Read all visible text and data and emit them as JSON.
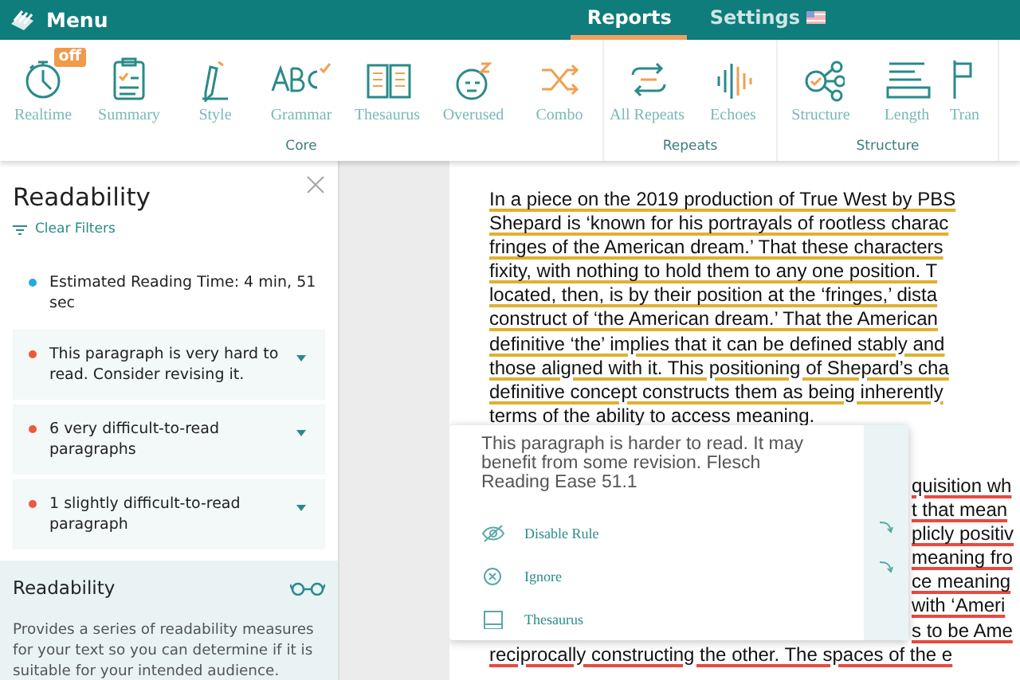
{
  "header": {
    "menu": "Menu",
    "tabs": [
      {
        "label": "Reports",
        "selected": true
      },
      {
        "label": "Settings",
        "selected": false
      }
    ]
  },
  "toolbar": {
    "groups": [
      {
        "label": "Core",
        "items": [
          {
            "label": "Realtime",
            "badge": "off"
          },
          {
            "label": "Summary"
          },
          {
            "label": "Style"
          },
          {
            "label": "Grammar"
          },
          {
            "label": "Thesaurus"
          },
          {
            "label": "Overused"
          },
          {
            "label": "Combo"
          }
        ]
      },
      {
        "label": "Repeats",
        "items": [
          {
            "label": "All Repeats"
          },
          {
            "label": "Echoes"
          }
        ]
      },
      {
        "label": "Structure",
        "items": [
          {
            "label": "Structure"
          },
          {
            "label": "Length"
          },
          {
            "label": "Tran"
          }
        ]
      }
    ]
  },
  "sidebar": {
    "title": "Readability",
    "filter": "Clear Filters",
    "items": [
      {
        "kind": "info",
        "color": "#29a8e0",
        "text": "Estimated Reading Time: 4 min, 51 sec"
      },
      {
        "kind": "issue",
        "color": "#f0583a",
        "text": "This paragraph is very hard to read. Consider revising it."
      },
      {
        "kind": "issue",
        "color": "#f0583a",
        "text": "6 very difficult-to-read paragraphs"
      },
      {
        "kind": "issue",
        "color": "#f0583a",
        "text": "1 slightly difficult-to-read paragraph"
      }
    ],
    "about": {
      "title": "Readability",
      "text": "Provides a series of readability measures for your text so you can determine if it is suitable for your intended audience."
    }
  },
  "document": {
    "paragraphs": [
      {
        "kind": "hard",
        "lines": [
          "In a piece on the 2019 production of True West by PBS",
          "Shepard is ‘known for his portrayals of rootless charac",
          "fringes of the American dream.’ That these characters",
          "fixity, with nothing to hold them to any one position. T",
          "located, then, is by their position at the ‘fringes,’ dista",
          "construct of ‘the American dream.’ That the American",
          "definitive ‘the’ implies that it can be defined stably and",
          "those aligned with it. This positioning of Shepard’s cha",
          "definitive concept constructs them as being inherently",
          "terms of the ability to access meaning."
        ]
      },
      {
        "kind": "very-hard",
        "lines": [
          {
            "text": "quisition wh",
            "covered": true
          },
          {
            "text": "t that mean",
            "covered": true
          },
          {
            "text": "plicly positiv",
            "covered": true
          },
          {
            "text": "meaning fro",
            "covered": true
          },
          {
            "text": "ce meaning",
            "covered": true
          },
          {
            "text": "with ‘Ameri",
            "covered": true
          },
          {
            "text": "s to be Ame",
            "covered": true
          },
          {
            "text": "reciprocally constructing the other. The spaces of the e",
            "covered": false
          }
        ]
      }
    ]
  },
  "popup": {
    "message": "This paragraph is harder to read. It may benefit from some revision. Flesch Reading Ease 51.1",
    "actions": [
      {
        "label": "Disable Rule",
        "arrow": true
      },
      {
        "label": "Ignore",
        "arrow": true
      },
      {
        "label": "Thesaurus",
        "arrow": false
      }
    ]
  }
}
